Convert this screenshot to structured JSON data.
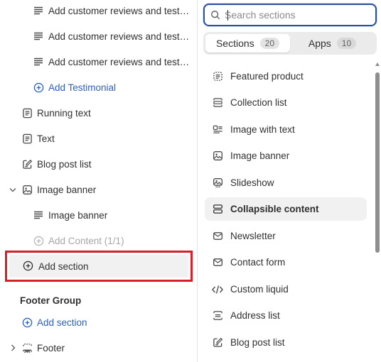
{
  "left_panel": {
    "rows": [
      {
        "label": "Add customer reviews and testimonials",
        "icon": "text-block-icon"
      },
      {
        "label": "Add customer reviews and testimonials",
        "icon": "text-block-icon"
      },
      {
        "label": "Add customer reviews and testimonials",
        "icon": "text-block-icon"
      },
      {
        "label": "Add Testimonial",
        "icon": "plus-circle-icon"
      },
      {
        "label": "Running text",
        "icon": "section-text-icon"
      },
      {
        "label": "Text",
        "icon": "section-text-icon"
      },
      {
        "label": "Blog post list",
        "icon": "edit-note-icon"
      },
      {
        "label": "Image banner",
        "icon": "image-icon"
      },
      {
        "label": "Image banner",
        "icon": "text-block-icon"
      },
      {
        "label": "Add Content (1/1)",
        "icon": "plus-circle-icon"
      },
      {
        "label": "Add section",
        "icon": "plus-circle-icon"
      },
      {
        "label": "Footer Group"
      },
      {
        "label": "Add section",
        "icon": "plus-circle-icon"
      },
      {
        "label": "Footer",
        "icon": "layout-footer-icon"
      }
    ]
  },
  "search": {
    "placeholder": "Search sections",
    "value": ""
  },
  "tabs": [
    {
      "label": "Sections",
      "count": "20",
      "active": true
    },
    {
      "label": "Apps",
      "count": "10",
      "active": false
    }
  ],
  "sections": [
    {
      "label": "Featured product",
      "icon": "featured-product-icon"
    },
    {
      "label": "Collection list",
      "icon": "collection-list-icon"
    },
    {
      "label": "Image with text",
      "icon": "image-with-text-icon"
    },
    {
      "label": "Image banner",
      "icon": "image-icon"
    },
    {
      "label": "Slideshow",
      "icon": "slideshow-icon"
    },
    {
      "label": "Collapsible content",
      "icon": "collapsible-icon",
      "selected": true
    },
    {
      "label": "Newsletter",
      "icon": "envelope-icon"
    },
    {
      "label": "Contact form",
      "icon": "envelope-icon"
    },
    {
      "label": "Custom liquid",
      "icon": "code-icon"
    },
    {
      "label": "Address list",
      "icon": "address-list-icon"
    },
    {
      "label": "Blog post list",
      "icon": "edit-note-icon"
    }
  ],
  "colors": {
    "accent_blue": "#2c5ec1",
    "highlight_red": "#d61f26",
    "selected_bg": "#f1f1f1"
  }
}
